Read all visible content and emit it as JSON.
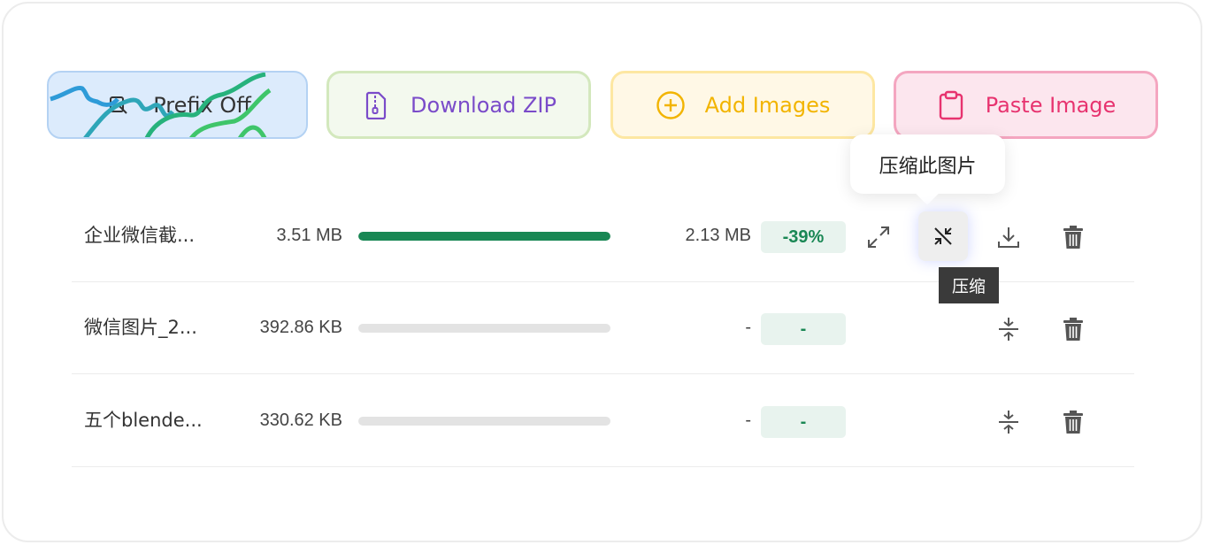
{
  "toolbar": {
    "prefix_label": "Prefix Off",
    "zip_label": "Download ZIP",
    "add_label": "Add Images",
    "paste_label": "Paste Image"
  },
  "popover": {
    "text": "压缩此图片"
  },
  "hover_tip": {
    "text": "压缩"
  },
  "files": [
    {
      "name": "企业微信截...",
      "size": "3.51 MB",
      "progress": 1.0,
      "new_size": "2.13 MB",
      "ratio": "-39%"
    },
    {
      "name": "微信图片_2...",
      "size": "392.86 KB",
      "progress": 0,
      "new_size": "-",
      "ratio": "-"
    },
    {
      "name": "五个blende...",
      "size": "330.62 KB",
      "progress": 0,
      "new_size": "-",
      "ratio": "-"
    }
  ],
  "colors": {
    "accent_green": "#198754",
    "zip_purple": "#7a4bc9",
    "add_yellow": "#f2b400",
    "paste_pink": "#e7336f"
  },
  "icons": [
    "filter-icon",
    "file-zip-icon",
    "plus-circle-icon",
    "clipboard-icon",
    "expand-icon",
    "compress-icon",
    "download-icon",
    "trash-icon",
    "merge-vertical-icon"
  ]
}
